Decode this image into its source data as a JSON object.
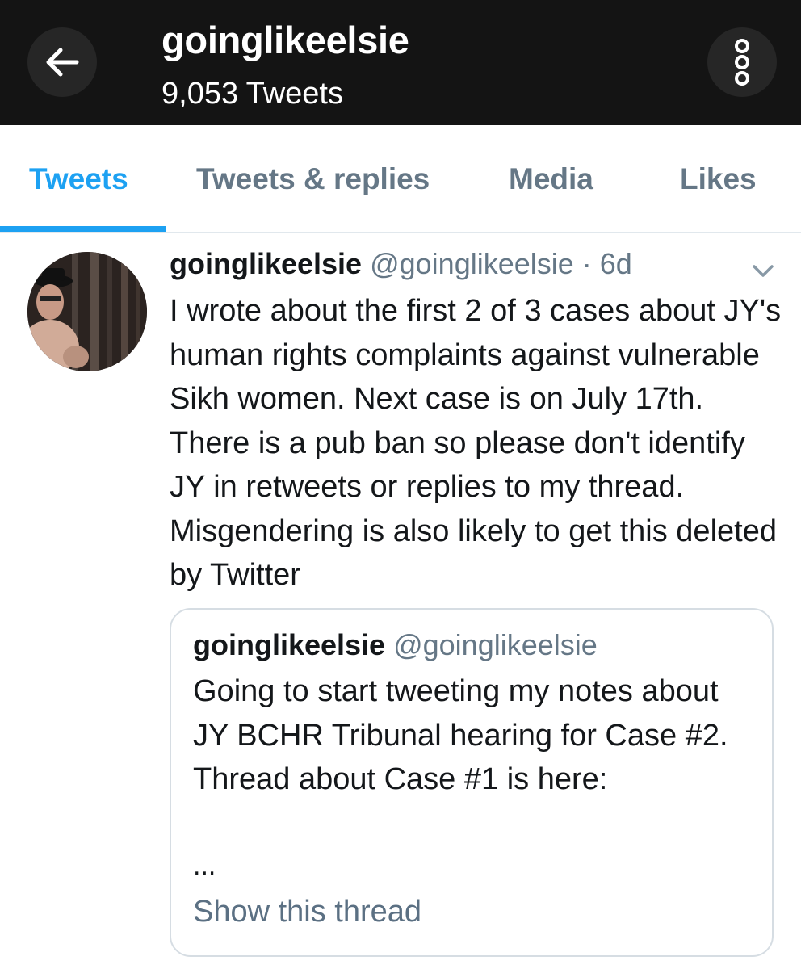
{
  "header": {
    "title": "goinglikeelsie",
    "tweet_count": "9,053",
    "tweet_count_label": "Tweets",
    "back_icon": "arrow-left-icon",
    "more_icon": "vertical-ellipsis-icon"
  },
  "tabs": [
    {
      "label": "Tweets",
      "active": true
    },
    {
      "label": "Tweets & replies",
      "active": false
    },
    {
      "label": "Media",
      "active": false
    },
    {
      "label": "Likes",
      "active": false
    }
  ],
  "tweet": {
    "display_name": "goinglikeelsie",
    "handle": "@goinglikeelsie",
    "time": "6d",
    "text": "I wrote about the first 2 of 3 cases about JY's human rights complaints against vulnerable Sikh women. Next case is on July 17th. There is a pub ban so please don't identify JY in retweets or replies to my thread. Misgendering is also likely to get this deleted by Twitter",
    "quoted": {
      "display_name": "goinglikeelsie",
      "handle": "@goinglikeelsie",
      "text": "Going to start tweeting my notes about JY BCHR Tribunal hearing for Case #2. Thread about Case #1 is here:",
      "ellipsis": "...",
      "show_thread": "Show this thread"
    }
  },
  "colors": {
    "accent": "#1da1f2",
    "header_bg": "#141414",
    "secondary_text": "#657786"
  }
}
